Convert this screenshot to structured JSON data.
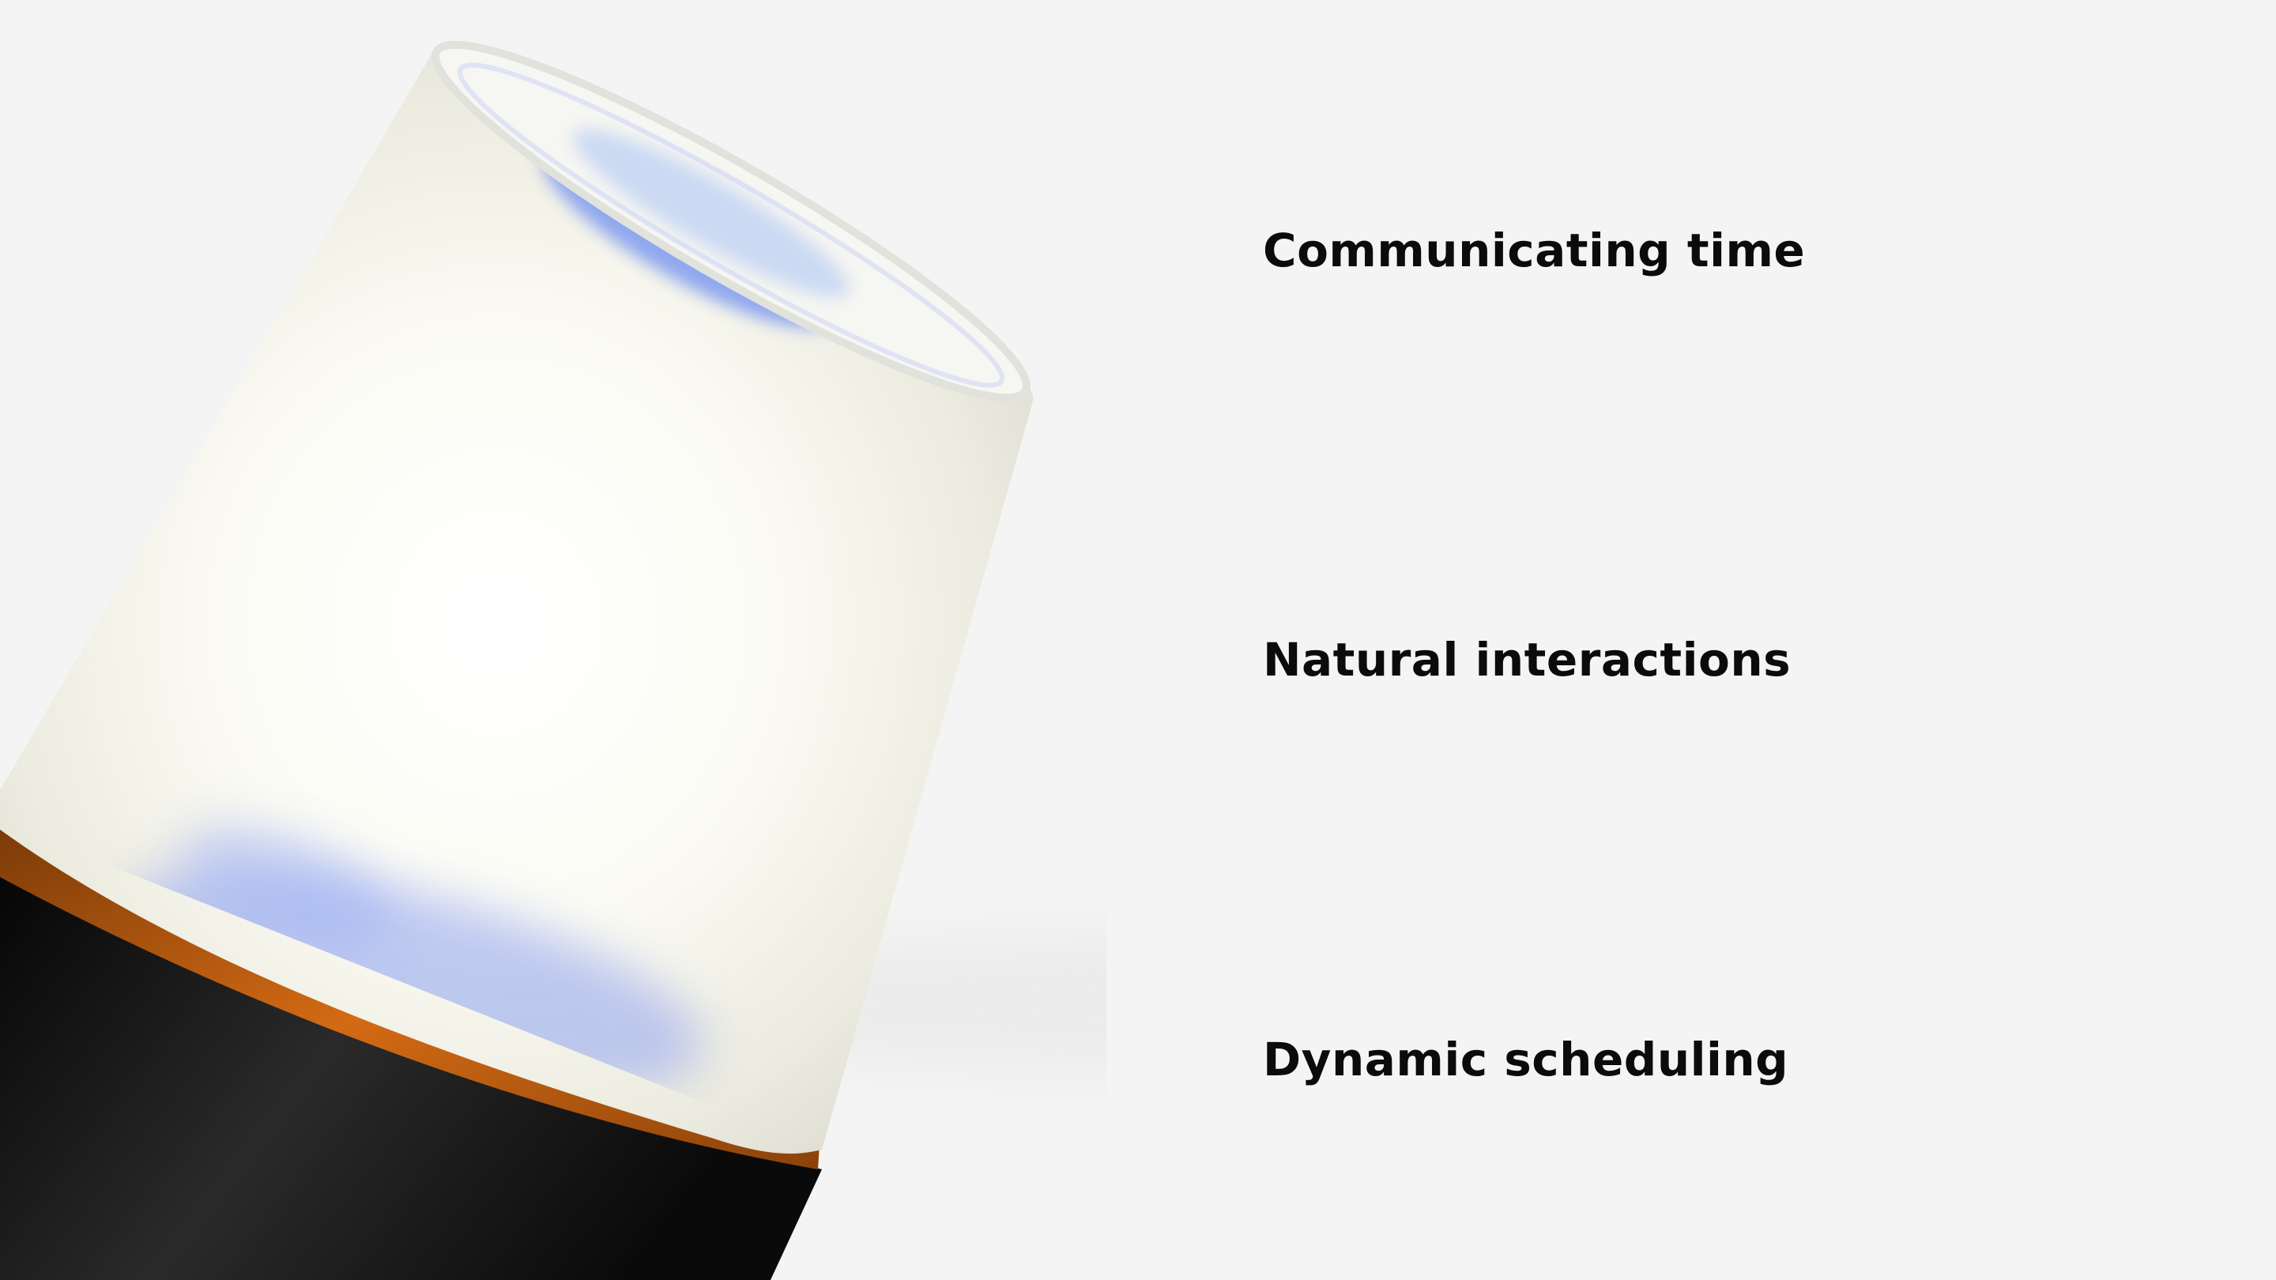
{
  "features": [
    "Communicating time",
    "Natural interactions",
    "Dynamic scheduling"
  ],
  "colors": {
    "background": "#f4f4f4",
    "text": "#0b0b0b",
    "frosted_shade": "#f7f6ee",
    "glow_blue": "#8fa2f0",
    "amber_ring": "#c25d10",
    "base": "#121212"
  }
}
